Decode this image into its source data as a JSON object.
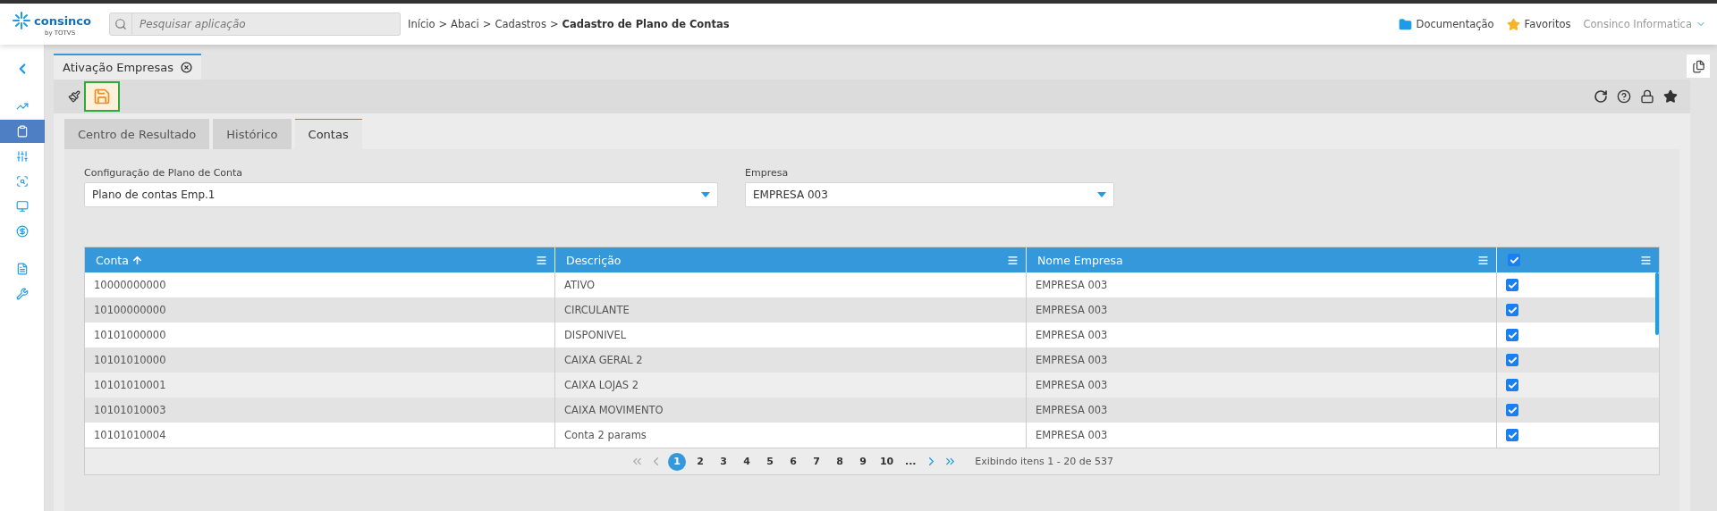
{
  "header": {
    "brand": "consinco",
    "brand_sub": "by TOTVS",
    "search": {
      "placeholder": "Pesquisar aplicação"
    },
    "breadcrumb": [
      "Início",
      "Abaci",
      "Cadastros"
    ],
    "breadcrumb_separator": ">",
    "breadcrumb_current": "Cadastro de Plano de Contas",
    "links": [
      {
        "kind": "folder",
        "label": "Documentação"
      },
      {
        "kind": "star",
        "label": "Favoritos"
      }
    ],
    "user": "Consinco Informatica"
  },
  "sidebar": {
    "items": [
      {
        "kind": "chart",
        "selected": false
      },
      {
        "kind": "clipboard",
        "selected": true
      },
      {
        "kind": "sliders",
        "selected": false
      },
      {
        "kind": "search",
        "selected": false
      },
      {
        "kind": "monitor",
        "selected": false
      },
      {
        "kind": "money",
        "selected": false
      },
      {
        "kind": "document",
        "selected": false
      },
      {
        "kind": "tools",
        "selected": false
      }
    ]
  },
  "page_tab": {
    "label": "Ativação Empresas",
    "selected": true
  },
  "tabs": [
    {
      "label": "Centro de Resultado",
      "selected": false
    },
    {
      "label": "Histórico",
      "selected": false
    },
    {
      "label": "Contas",
      "selected": true
    }
  ],
  "form": {
    "fields": [
      {
        "label": "Configuração de Plano de Conta",
        "value": "Plano de contas Emp.1"
      },
      {
        "label": "Empresa",
        "value": "EMPRESA 003"
      }
    ]
  },
  "table": {
    "columns": [
      {
        "label": "Conta",
        "sorted": true
      },
      {
        "label": "Descrição",
        "sorted": false
      },
      {
        "label": "Nome Empresa",
        "sorted": false
      }
    ],
    "header_checked": true,
    "rows": [
      {
        "conta": "10000000000",
        "descricao": "ATIVO",
        "empresa": "EMPRESA 003",
        "checked": true,
        "hovered": false
      },
      {
        "conta": "10100000000",
        "descricao": "CIRCULANTE",
        "empresa": "EMPRESA 003",
        "checked": true,
        "hovered": false
      },
      {
        "conta": "10101000000",
        "descricao": "DISPONIVEL",
        "empresa": "EMPRESA 003",
        "checked": true,
        "hovered": false
      },
      {
        "conta": "10101010000",
        "descricao": "CAIXA GERAL 2",
        "empresa": "EMPRESA 003",
        "checked": true,
        "hovered": false
      },
      {
        "conta": "10101010001",
        "descricao": "CAIXA LOJAS 2",
        "empresa": "EMPRESA 003",
        "checked": true,
        "hovered": true
      },
      {
        "conta": "10101010003",
        "descricao": "CAIXA MOVIMENTO",
        "empresa": "EMPRESA 003",
        "checked": true,
        "hovered": false
      },
      {
        "conta": "10101010004",
        "descricao": "Conta 2 params",
        "empresa": "EMPRESA 003",
        "checked": true,
        "hovered": false
      }
    ]
  },
  "pagination": {
    "pages": [
      {
        "label": "1",
        "selected": true
      },
      {
        "label": "2",
        "selected": false
      },
      {
        "label": "3",
        "selected": false
      },
      {
        "label": "4",
        "selected": false
      },
      {
        "label": "5",
        "selected": false
      },
      {
        "label": "6",
        "selected": false
      },
      {
        "label": "7",
        "selected": false
      },
      {
        "label": "8",
        "selected": false
      },
      {
        "label": "9",
        "selected": false
      },
      {
        "label": "10",
        "selected": false
      }
    ],
    "more": "...",
    "info": "Exibindo itens 1 - 20 de 537"
  }
}
